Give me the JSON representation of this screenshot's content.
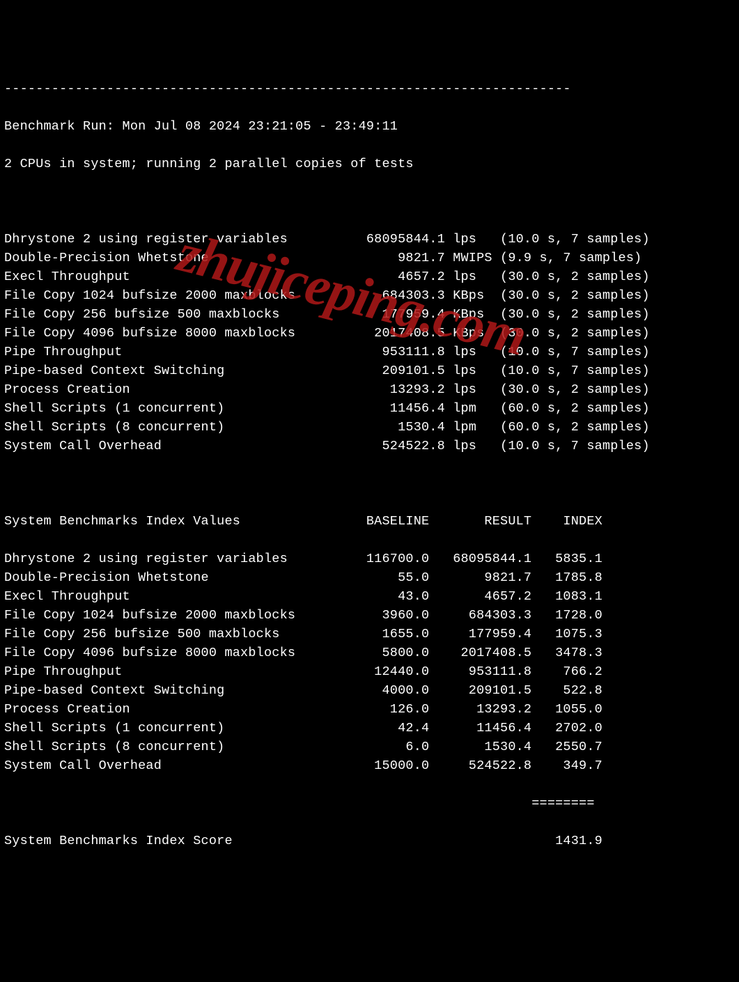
{
  "separator": "------------------------------------------------------------------------",
  "header": {
    "run_line": "Benchmark Run: Mon Jul 08 2024 23:21:05 - 23:49:11",
    "cpu_line": "2 CPUs in system; running 2 parallel copies of tests"
  },
  "results": [
    {
      "name": "Dhrystone 2 using register variables",
      "value": "68095844.1",
      "unit": "lps",
      "timing": "(10.0 s, 7 samples)"
    },
    {
      "name": "Double-Precision Whetstone",
      "value": "9821.7",
      "unit": "MWIPS",
      "timing": "(9.9 s, 7 samples)"
    },
    {
      "name": "Execl Throughput",
      "value": "4657.2",
      "unit": "lps",
      "timing": "(30.0 s, 2 samples)"
    },
    {
      "name": "File Copy 1024 bufsize 2000 maxblocks",
      "value": "684303.3",
      "unit": "KBps",
      "timing": "(30.0 s, 2 samples)"
    },
    {
      "name": "File Copy 256 bufsize 500 maxblocks",
      "value": "177959.4",
      "unit": "KBps",
      "timing": "(30.0 s, 2 samples)"
    },
    {
      "name": "File Copy 4096 bufsize 8000 maxblocks",
      "value": "2017408.5",
      "unit": "KBps",
      "timing": "(30.0 s, 2 samples)"
    },
    {
      "name": "Pipe Throughput",
      "value": "953111.8",
      "unit": "lps",
      "timing": "(10.0 s, 7 samples)"
    },
    {
      "name": "Pipe-based Context Switching",
      "value": "209101.5",
      "unit": "lps",
      "timing": "(10.0 s, 7 samples)"
    },
    {
      "name": "Process Creation",
      "value": "13293.2",
      "unit": "lps",
      "timing": "(30.0 s, 2 samples)"
    },
    {
      "name": "Shell Scripts (1 concurrent)",
      "value": "11456.4",
      "unit": "lpm",
      "timing": "(60.0 s, 2 samples)"
    },
    {
      "name": "Shell Scripts (8 concurrent)",
      "value": "1530.4",
      "unit": "lpm",
      "timing": "(60.0 s, 2 samples)"
    },
    {
      "name": "System Call Overhead",
      "value": "524522.8",
      "unit": "lps",
      "timing": "(10.0 s, 7 samples)"
    }
  ],
  "index_header": {
    "title": "System Benchmarks Index Values",
    "col_baseline": "BASELINE",
    "col_result": "RESULT",
    "col_index": "INDEX"
  },
  "index_rows": [
    {
      "name": "Dhrystone 2 using register variables",
      "baseline": "116700.0",
      "result": "68095844.1",
      "index": "5835.1"
    },
    {
      "name": "Double-Precision Whetstone",
      "baseline": "55.0",
      "result": "9821.7",
      "index": "1785.8"
    },
    {
      "name": "Execl Throughput",
      "baseline": "43.0",
      "result": "4657.2",
      "index": "1083.1"
    },
    {
      "name": "File Copy 1024 bufsize 2000 maxblocks",
      "baseline": "3960.0",
      "result": "684303.3",
      "index": "1728.0"
    },
    {
      "name": "File Copy 256 bufsize 500 maxblocks",
      "baseline": "1655.0",
      "result": "177959.4",
      "index": "1075.3"
    },
    {
      "name": "File Copy 4096 bufsize 8000 maxblocks",
      "baseline": "5800.0",
      "result": "2017408.5",
      "index": "3478.3"
    },
    {
      "name": "Pipe Throughput",
      "baseline": "12440.0",
      "result": "953111.8",
      "index": "766.2"
    },
    {
      "name": "Pipe-based Context Switching",
      "baseline": "4000.0",
      "result": "209101.5",
      "index": "522.8"
    },
    {
      "name": "Process Creation",
      "baseline": "126.0",
      "result": "13293.2",
      "index": "1055.0"
    },
    {
      "name": "Shell Scripts (1 concurrent)",
      "baseline": "42.4",
      "result": "11456.4",
      "index": "2702.0"
    },
    {
      "name": "Shell Scripts (8 concurrent)",
      "baseline": "6.0",
      "result": "1530.4",
      "index": "2550.7"
    },
    {
      "name": "System Call Overhead",
      "baseline": "15000.0",
      "result": "524522.8",
      "index": "349.7"
    }
  ],
  "score_separator": "                                                                   ========",
  "score": {
    "label": "System Benchmarks Index Score",
    "value": "1431.9"
  },
  "watermark": "zhujiceping.com"
}
